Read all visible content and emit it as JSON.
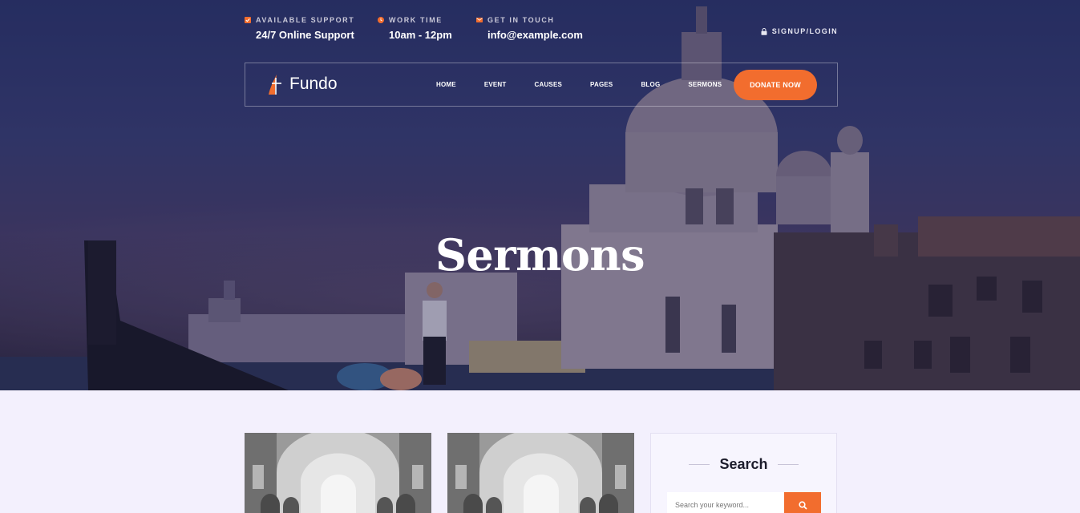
{
  "topbar": {
    "support": {
      "label": "AVAILABLE SUPPORT",
      "value": "24/7 Online Support",
      "icon": "checkbox-icon"
    },
    "work": {
      "label": "WORK TIME",
      "value": "10am - 12pm",
      "icon": "clock-icon"
    },
    "contact": {
      "label": "GET IN TOUCH",
      "value": "info@example.com",
      "icon": "envelope-icon"
    },
    "signup": "SIGNUP/LOGIN"
  },
  "brand": {
    "name": "Fundo",
    "accent": "#f26d2e"
  },
  "nav": {
    "items": [
      "HOME",
      "EVENT",
      "CAUSES",
      "PAGES",
      "BLOG",
      "SERMONS"
    ],
    "donate": "DONATE NOW"
  },
  "hero": {
    "title": "Sermons"
  },
  "sidebar": {
    "title": "Search",
    "search_placeholder": "Search your keyword..."
  }
}
